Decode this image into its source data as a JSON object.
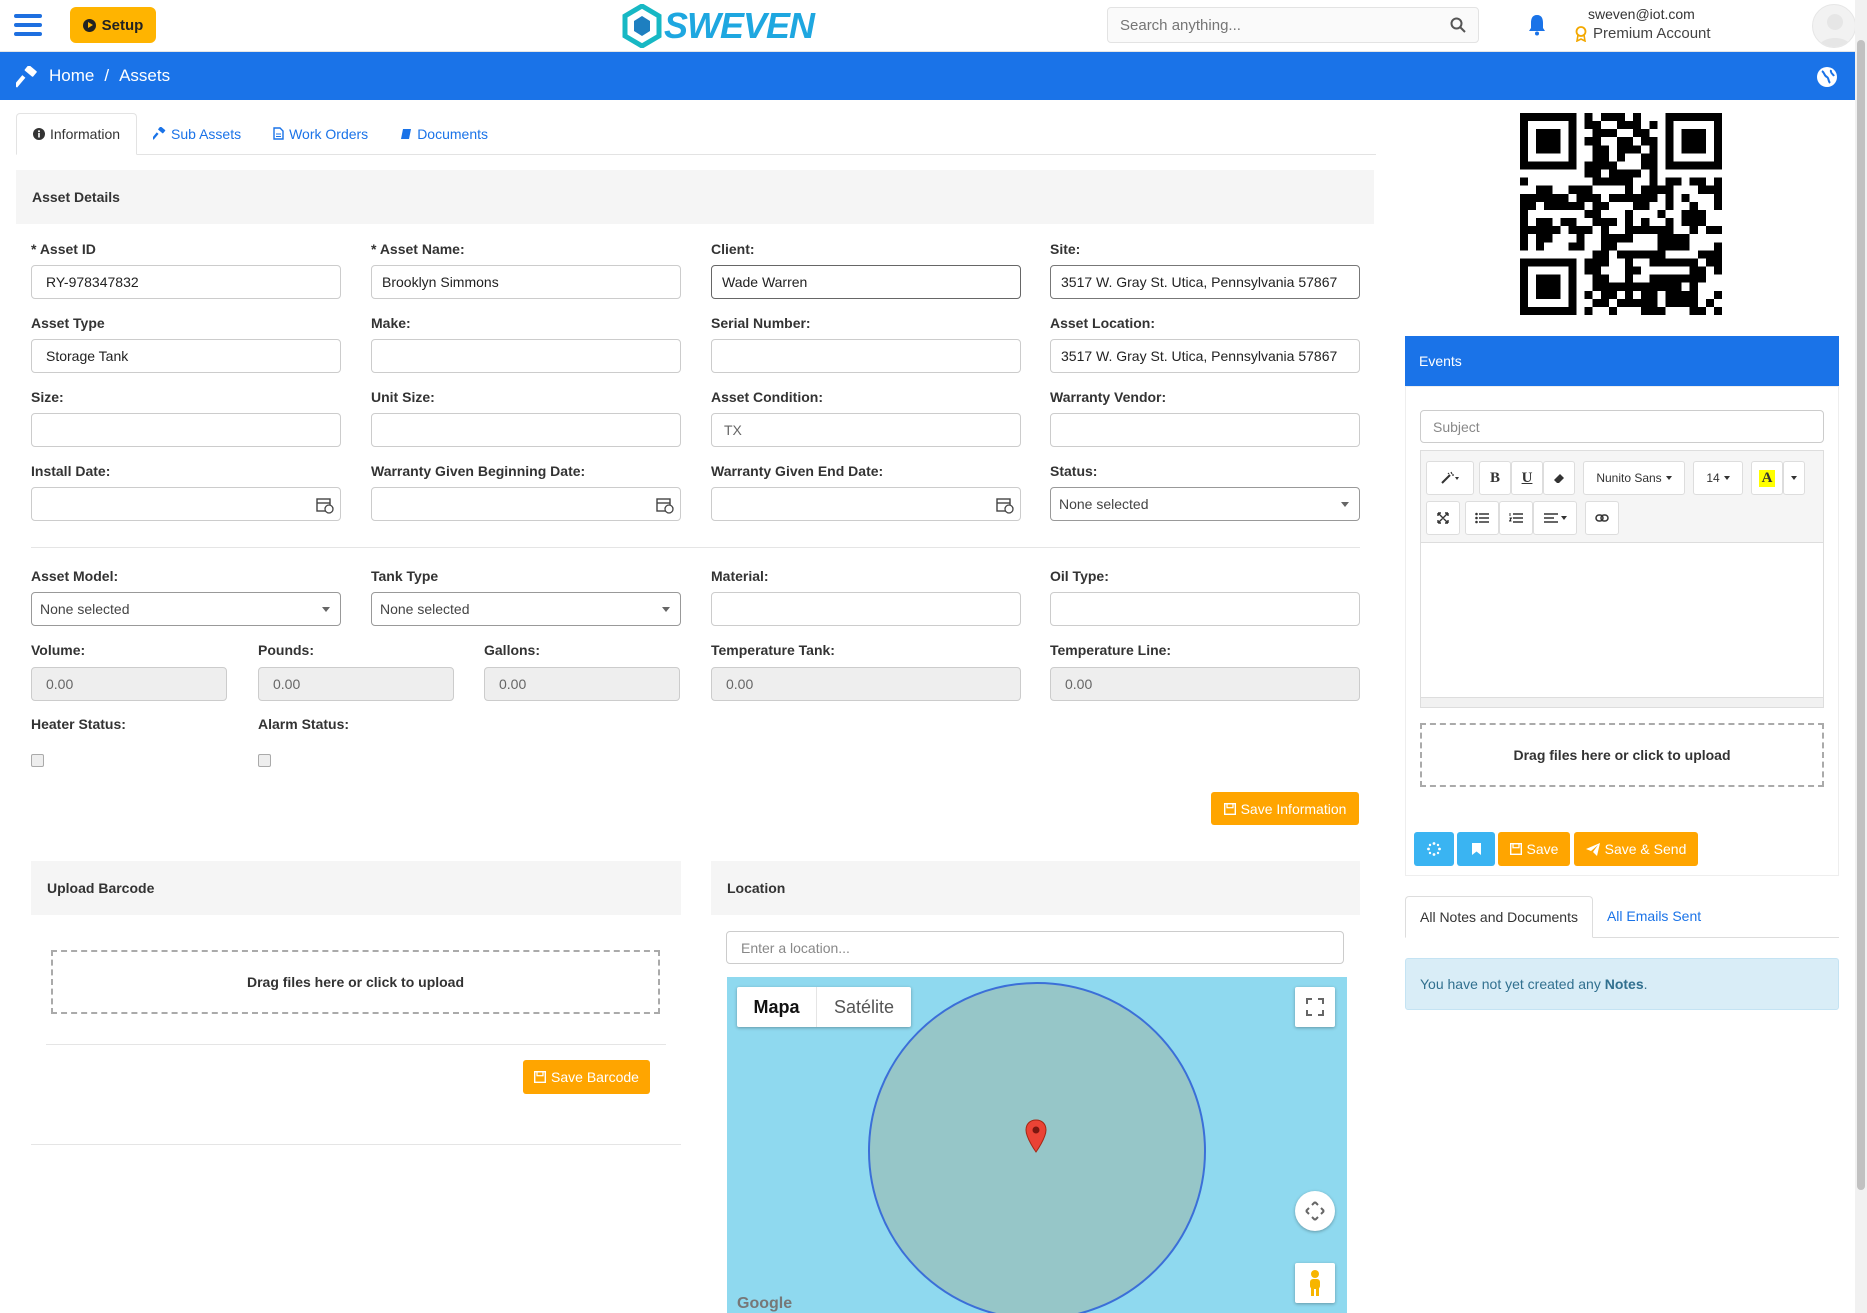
{
  "header": {
    "setup_label": "Setup",
    "logo_text": "SWEVEN",
    "search_placeholder": "Search anything...",
    "user_email": "sweven@iot.com",
    "account_type": "Premium Account"
  },
  "breadcrumb": {
    "home": "Home",
    "separator": "/",
    "current": "Assets"
  },
  "tabs": [
    "Information",
    "Sub Assets",
    "Work Orders",
    "Documents"
  ],
  "asset_details": {
    "title": "Asset Details",
    "asset_id_label": "* Asset ID",
    "asset_id": "RY-978347832",
    "asset_name_label": "* Asset Name:",
    "asset_name": "Brooklyn Simmons",
    "client_label": "Client:",
    "client": "Wade Warren",
    "site_label": "Site:",
    "site": "3517 W. Gray St. Utica, Pennsylvania 57867",
    "asset_type_label": "Asset Type",
    "asset_type": "Storage Tank",
    "make_label": "Make:",
    "serial_label": "Serial Number:",
    "asset_location_label": "Asset Location:",
    "asset_location": "3517 W. Gray St. Utica, Pennsylvania 57867",
    "size_label": "Size:",
    "unit_size_label": "Unit Size:",
    "asset_condition_label": "Asset Condition:",
    "asset_condition": "TX",
    "warranty_vendor_label": "Warranty Vendor:",
    "install_date_label": "Install Date:",
    "warranty_begin_label": "Warranty Given Beginning Date:",
    "warranty_end_label": "Warranty Given End Date:",
    "status_label": "Status:",
    "status": "None selected",
    "asset_model_label": "Asset Model:",
    "asset_model": "None selected",
    "tank_type_label": "Tank Type",
    "tank_type": "None selected",
    "material_label": "Material:",
    "oil_type_label": "Oil Type:",
    "volume_label": "Volume:",
    "volume": "0.00",
    "pounds_label": "Pounds:",
    "pounds": "0.00",
    "gallons_label": "Gallons:",
    "gallons": "0.00",
    "temp_tank_label": "Temperature Tank:",
    "temp_tank": "0.00",
    "temp_line_label": "Temperature Line:",
    "temp_line": "0.00",
    "heater_status_label": "Heater Status:",
    "alarm_status_label": "Alarm Status:",
    "save_information": "Save Information"
  },
  "upload_barcode": {
    "title": "Upload Barcode",
    "dropzone": "Drag files here or click to upload",
    "save_label": "Save Barcode"
  },
  "location": {
    "title": "Location",
    "placeholder": "Enter a location...",
    "map_type_map": "Mapa",
    "map_type_satellite": "Satélite",
    "attribution": "Google"
  },
  "events": {
    "title": "Events",
    "subject_placeholder": "Subject",
    "font_name": "Nunito Sans",
    "font_size": "14",
    "bold": "B",
    "underline": "U",
    "highlight": "A",
    "dropzone": "Drag files here or click to upload",
    "save_label": "Save",
    "save_send_label": "Save & Send"
  },
  "notes": {
    "tab_all_notes": "All Notes and Documents",
    "tab_all_emails": "All Emails Sent",
    "empty_prefix": "You have not yet created any ",
    "empty_link": "Notes",
    "empty_suffix": "."
  },
  "colors": {
    "primary": "#1a73e8",
    "accent": "#ffa500",
    "setup": "#ffb400",
    "cyan": "#3ab4f2",
    "map_water": "#8fd9ef"
  }
}
